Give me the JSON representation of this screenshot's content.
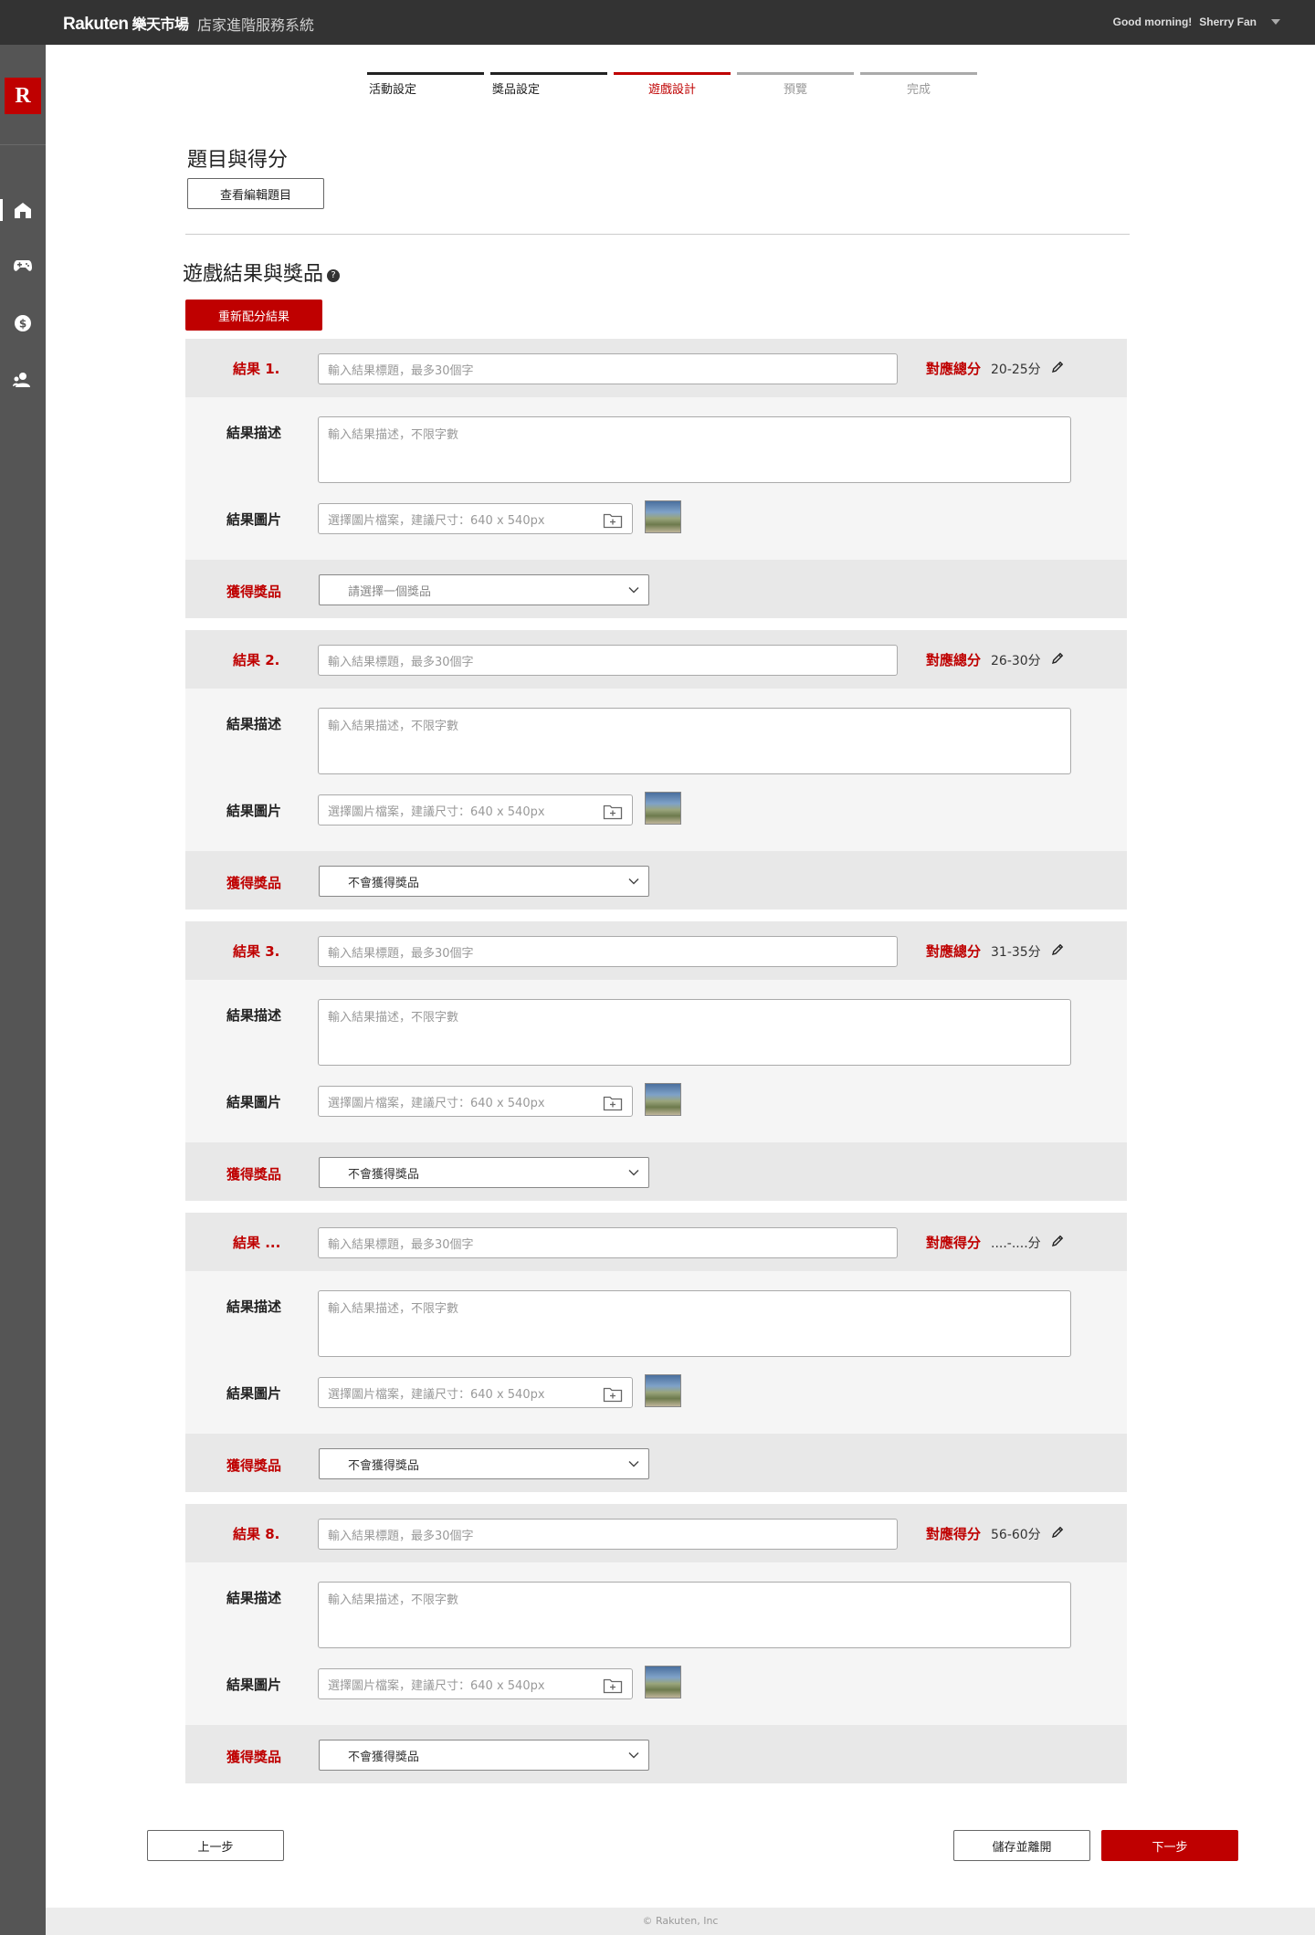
{
  "header": {
    "brand": "Rakuten",
    "brand_cjk": "樂天市場",
    "system_name": "店家進階服務系統",
    "greeting": "Good morning!",
    "user_name": "Sherry Fan"
  },
  "sidebar": {
    "brand_letter": "R",
    "items": [
      {
        "icon": "home-icon",
        "active": true
      },
      {
        "icon": "gamepad-icon",
        "active": false
      },
      {
        "icon": "dollar-icon",
        "active": false
      },
      {
        "icon": "users-icon",
        "active": false
      }
    ]
  },
  "steps": [
    {
      "label": "活動設定",
      "state": "done"
    },
    {
      "label": "獎品設定",
      "state": "done"
    },
    {
      "label": "遊戲設計",
      "state": "current"
    },
    {
      "label": "預覽",
      "state": "todo"
    },
    {
      "label": "完成",
      "state": "todo"
    }
  ],
  "questions": {
    "title": "題目與得分",
    "view_button": "查看編輯題目"
  },
  "results_section": {
    "title": "遊戲結果與獎品",
    "reallocate_button": "重新配分結果",
    "desc_label": "結果描述",
    "image_label": "結果圖片",
    "prize_label": "獲得獎品",
    "title_placeholder": "輸入結果標題，最多30個字",
    "desc_placeholder": "輸入結果描述，不限字數",
    "image_placeholder": "選擇圖片檔案，建議尺寸：640 x 540px"
  },
  "results": [
    {
      "label": "結果 1.",
      "score_label": "對應總分",
      "score_range": "20-25分",
      "prize": "請選擇一個獎品",
      "prize_is_placeholder": true
    },
    {
      "label": "結果 2.",
      "score_label": "對應總分",
      "score_range": "26-30分",
      "prize": "不會獲得獎品",
      "prize_is_placeholder": false
    },
    {
      "label": "結果 3.",
      "score_label": "對應總分",
      "score_range": "31-35分",
      "prize": "不會獲得獎品",
      "prize_is_placeholder": false
    },
    {
      "label": "結果 ...",
      "score_label": "對應得分",
      "score_range": "....-....分",
      "prize": "不會獲得獎品",
      "prize_is_placeholder": false
    },
    {
      "label": "結果 8.",
      "score_label": "對應得分",
      "score_range": "56-60分",
      "prize": "不會獲得獎品",
      "prize_is_placeholder": false
    }
  ],
  "footer_nav": {
    "prev_button": "上一步",
    "save_button": "儲存並離開",
    "next_button": "下一步"
  },
  "copyright": "© Rakuten, Inc",
  "colors": {
    "accent": "#bf0000",
    "topbar": "#333333",
    "sidebar": "#555555",
    "card_bg": "#f5f5f5",
    "card_band": "#e8e8e8"
  }
}
